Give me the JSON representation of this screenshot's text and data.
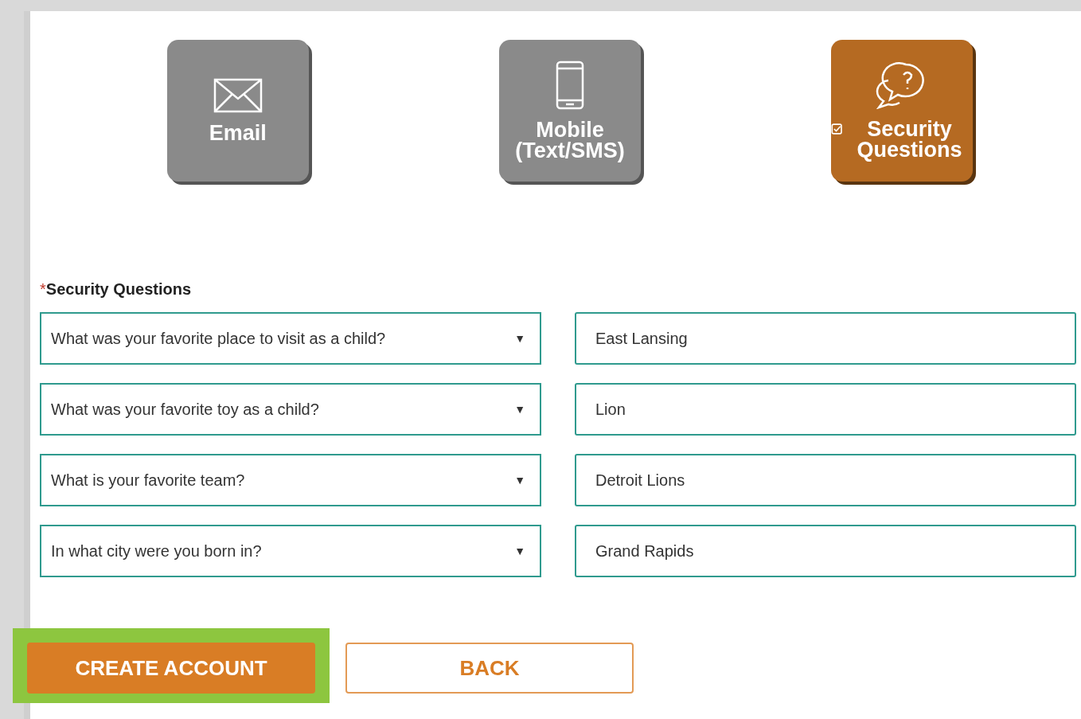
{
  "methods": [
    {
      "kind": "email",
      "label": "Email",
      "selected": false
    },
    {
      "kind": "mobile",
      "label": "Mobile (Text/SMS)",
      "selected": false
    },
    {
      "kind": "questions",
      "label": "Security Questions",
      "selected": true
    }
  ],
  "security_questions": {
    "required_mark": "*",
    "label": "Security Questions",
    "rows": [
      {
        "question": "What was your favorite place to visit as a child?",
        "caret": "▼",
        "answer": "East Lansing"
      },
      {
        "question": "What was your favorite toy as a child?",
        "caret": "▼",
        "answer": "Lion"
      },
      {
        "question": "What is your favorite team?",
        "caret": "▼",
        "answer": "Detroit Lions"
      },
      {
        "question": "In what city were you born in?",
        "caret": "▼",
        "answer": "Grand Rapids"
      }
    ]
  },
  "buttons": {
    "create": {
      "label": "CREATE ACCOUNT",
      "highlighted": true
    },
    "back": {
      "label": "BACK"
    }
  }
}
